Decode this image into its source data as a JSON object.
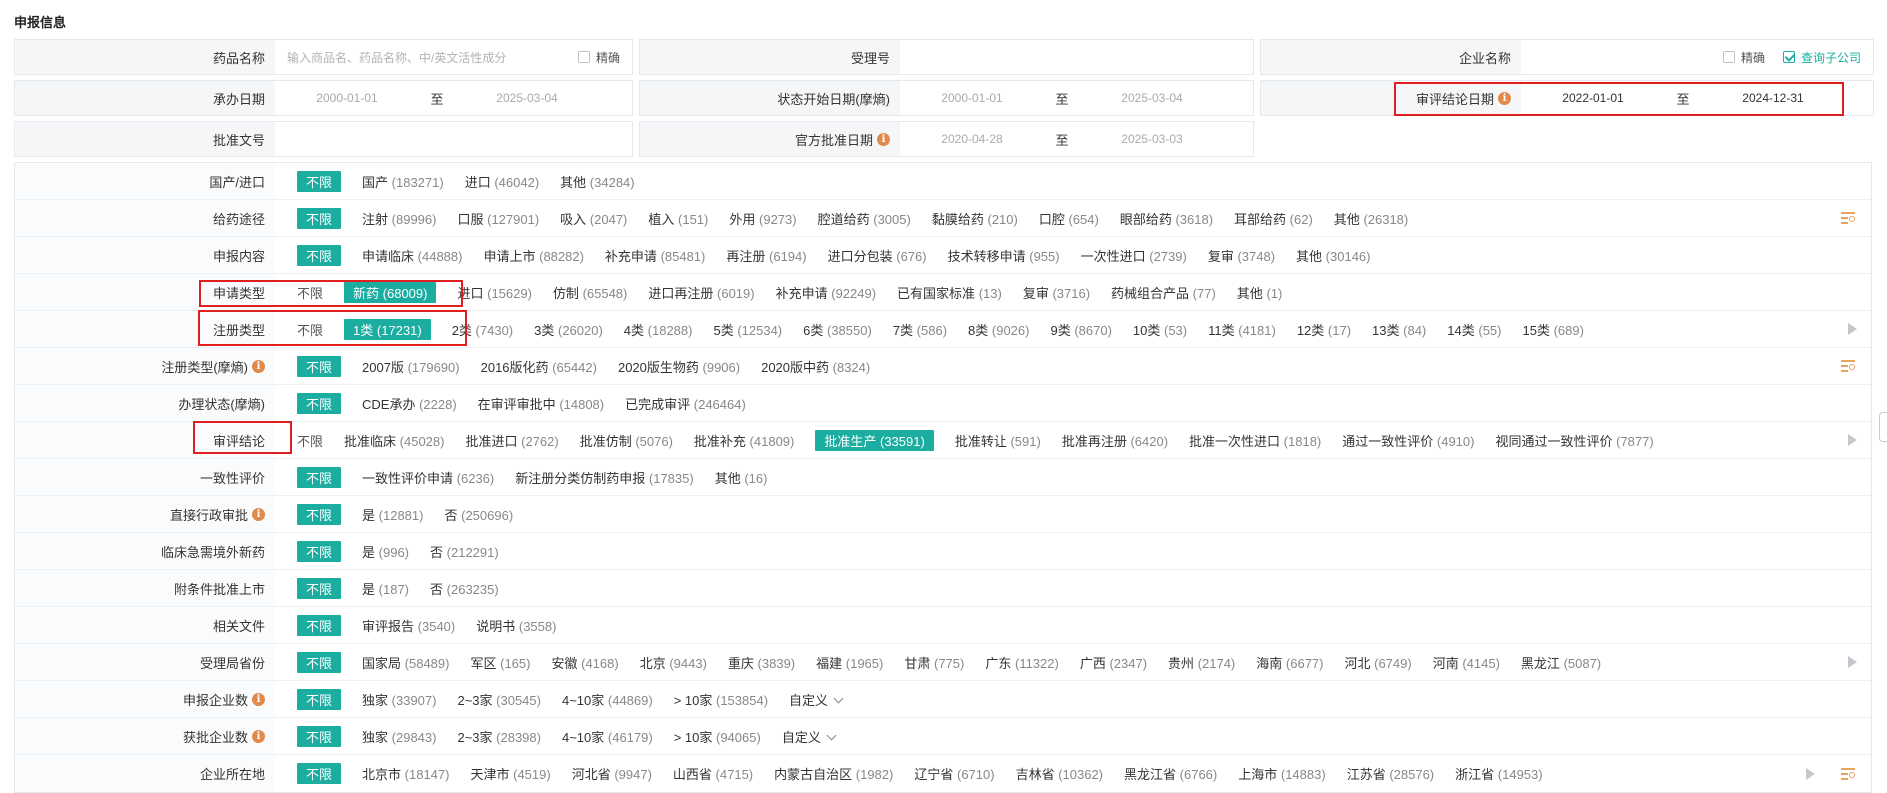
{
  "section_title": "申报信息",
  "form": {
    "row1": {
      "drug_name_label": "药品名称",
      "drug_name_placeholder": "输入商品名、药品名称、中/英文活性成分",
      "exact_label": "精确",
      "accept_no_label": "受理号",
      "company_label": "企业名称",
      "company_exact_label": "精确",
      "subsidiary_label": "查询子公司"
    },
    "row2": {
      "undertake_label": "承办日期",
      "undertake_from": "2000-01-01",
      "undertake_to": "2025-03-04",
      "status_start_label": "状态开始日期(摩熵)",
      "status_from": "2000-01-01",
      "status_to": "2025-03-04",
      "review_date_label": "审评结论日期",
      "review_from": "2022-01-01",
      "review_to": "2024-12-31",
      "to_text": "至"
    },
    "row3": {
      "approval_no_label": "批准文号",
      "official_date_label": "官方批准日期",
      "official_from": "2020-04-28",
      "official_to": "2025-03-03",
      "to_text": "至"
    }
  },
  "filters": [
    {
      "label": "国产/进口",
      "options": [
        {
          "t": "不限",
          "sel": true
        },
        {
          "t": "国产",
          "c": "(183271)"
        },
        {
          "t": "进口",
          "c": "(46042)"
        },
        {
          "t": "其他",
          "c": "(34284)"
        }
      ]
    },
    {
      "label": "给药途径",
      "tools": [
        "list-search"
      ],
      "options": [
        {
          "t": "不限",
          "sel": true
        },
        {
          "t": "注射",
          "c": "(89996)"
        },
        {
          "t": "口服",
          "c": "(127901)"
        },
        {
          "t": "吸入",
          "c": "(2047)"
        },
        {
          "t": "植入",
          "c": "(151)"
        },
        {
          "t": "外用",
          "c": "(9273)"
        },
        {
          "t": "腔道给药",
          "c": "(3005)"
        },
        {
          "t": "黏膜给药",
          "c": "(210)"
        },
        {
          "t": "口腔",
          "c": "(654)"
        },
        {
          "t": "眼部给药",
          "c": "(3618)"
        },
        {
          "t": "耳部给药",
          "c": "(62)"
        },
        {
          "t": "其他",
          "c": "(26318)"
        }
      ]
    },
    {
      "label": "申报内容",
      "options": [
        {
          "t": "不限",
          "sel": true
        },
        {
          "t": "申请临床",
          "c": "(44888)"
        },
        {
          "t": "申请上市",
          "c": "(88282)"
        },
        {
          "t": "补充申请",
          "c": "(85481)"
        },
        {
          "t": "再注册",
          "c": "(6194)"
        },
        {
          "t": "进口分包装",
          "c": "(676)"
        },
        {
          "t": "技术转移申请",
          "c": "(955)"
        },
        {
          "t": "一次性进口",
          "c": "(2739)"
        },
        {
          "t": "复审",
          "c": "(3748)"
        },
        {
          "t": "其他",
          "c": "(30146)"
        }
      ]
    },
    {
      "label": "申请类型",
      "options": [
        {
          "t": "不限",
          "plain": true
        },
        {
          "t": "新药",
          "c": "(68009)",
          "sel": true
        },
        {
          "t": "进口",
          "c": "(15629)"
        },
        {
          "t": "仿制",
          "c": "(65548)"
        },
        {
          "t": "进口再注册",
          "c": "(6019)"
        },
        {
          "t": "补充申请",
          "c": "(92249)"
        },
        {
          "t": "已有国家标准",
          "c": "(13)"
        },
        {
          "t": "复审",
          "c": "(3716)"
        },
        {
          "t": "药械组合产品",
          "c": "(77)"
        },
        {
          "t": "其他",
          "c": "(1)"
        }
      ]
    },
    {
      "label": "注册类型",
      "tools": [
        "play"
      ],
      "options": [
        {
          "t": "不限",
          "plain": true
        },
        {
          "t": "1类",
          "c": "(17231)",
          "sel": true
        },
        {
          "t": "2类",
          "c": "(7430)"
        },
        {
          "t": "3类",
          "c": "(26020)"
        },
        {
          "t": "4类",
          "c": "(18288)"
        },
        {
          "t": "5类",
          "c": "(12534)"
        },
        {
          "t": "6类",
          "c": "(38550)"
        },
        {
          "t": "7类",
          "c": "(586)"
        },
        {
          "t": "8类",
          "c": "(9026)"
        },
        {
          "t": "9类",
          "c": "(8670)"
        },
        {
          "t": "10类",
          "c": "(53)"
        },
        {
          "t": "11类",
          "c": "(4181)"
        },
        {
          "t": "12类",
          "c": "(17)"
        },
        {
          "t": "13类",
          "c": "(84)"
        },
        {
          "t": "14类",
          "c": "(55)"
        },
        {
          "t": "15类",
          "c": "(689)"
        }
      ]
    },
    {
      "label": "注册类型(摩熵)",
      "info": true,
      "tools": [
        "list-search"
      ],
      "options": [
        {
          "t": "不限",
          "sel": true
        },
        {
          "t": "2007版",
          "c": "(179690)"
        },
        {
          "t": "2016版化药",
          "c": "(65442)"
        },
        {
          "t": "2020版生物药",
          "c": "(9906)"
        },
        {
          "t": "2020版中药",
          "c": "(8324)"
        }
      ]
    },
    {
      "label": "办理状态(摩熵)",
      "options": [
        {
          "t": "不限",
          "sel": true
        },
        {
          "t": "CDE承办",
          "c": "(2228)"
        },
        {
          "t": "在审评审批中",
          "c": "(14808)"
        },
        {
          "t": "已完成审评",
          "c": "(246464)"
        }
      ]
    },
    {
      "label": "审评结论",
      "tools": [
        "play"
      ],
      "options": [
        {
          "t": "不限",
          "plain": true
        },
        {
          "t": "批准临床",
          "c": "(45028)"
        },
        {
          "t": "批准进口",
          "c": "(2762)"
        },
        {
          "t": "批准仿制",
          "c": "(5076)"
        },
        {
          "t": "批准补充",
          "c": "(41809)"
        },
        {
          "t": "批准生产",
          "c": "(33591)",
          "sel": true
        },
        {
          "t": "批准转让",
          "c": "(591)"
        },
        {
          "t": "批准再注册",
          "c": "(6420)"
        },
        {
          "t": "批准一次性进口",
          "c": "(1818)"
        },
        {
          "t": "通过一致性评价",
          "c": "(4910)"
        },
        {
          "t": "视同通过一致性评价",
          "c": "(7877)"
        }
      ]
    },
    {
      "label": "一致性评价",
      "options": [
        {
          "t": "不限",
          "sel": true
        },
        {
          "t": "一致性评价申请",
          "c": "(6236)"
        },
        {
          "t": "新注册分类仿制药申报",
          "c": "(17835)"
        },
        {
          "t": "其他",
          "c": "(16)"
        }
      ]
    },
    {
      "label": "直接行政审批",
      "info": true,
      "options": [
        {
          "t": "不限",
          "sel": true
        },
        {
          "t": "是",
          "c": "(12881)"
        },
        {
          "t": "否",
          "c": "(250696)"
        }
      ]
    },
    {
      "label": "临床急需境外新药",
      "options": [
        {
          "t": "不限",
          "sel": true
        },
        {
          "t": "是",
          "c": "(996)"
        },
        {
          "t": "否",
          "c": "(212291)"
        }
      ]
    },
    {
      "label": "附条件批准上市",
      "options": [
        {
          "t": "不限",
          "sel": true
        },
        {
          "t": "是",
          "c": "(187)"
        },
        {
          "t": "否",
          "c": "(263235)"
        }
      ]
    },
    {
      "label": "相关文件",
      "options": [
        {
          "t": "不限",
          "sel": true
        },
        {
          "t": "审评报告",
          "c": "(3540)"
        },
        {
          "t": "说明书",
          "c": "(3558)"
        }
      ]
    },
    {
      "label": "受理局省份",
      "tools": [
        "play"
      ],
      "options": [
        {
          "t": "不限",
          "sel": true
        },
        {
          "t": "国家局",
          "c": "(58489)"
        },
        {
          "t": "军区",
          "c": "(165)"
        },
        {
          "t": "安徽",
          "c": "(4168)"
        },
        {
          "t": "北京",
          "c": "(9443)"
        },
        {
          "t": "重庆",
          "c": "(3839)"
        },
        {
          "t": "福建",
          "c": "(1965)"
        },
        {
          "t": "甘肃",
          "c": "(775)"
        },
        {
          "t": "广东",
          "c": "(11322)"
        },
        {
          "t": "广西",
          "c": "(2347)"
        },
        {
          "t": "贵州",
          "c": "(2174)"
        },
        {
          "t": "海南",
          "c": "(6677)"
        },
        {
          "t": "河北",
          "c": "(6749)"
        },
        {
          "t": "河南",
          "c": "(4145)"
        },
        {
          "t": "黑龙江",
          "c": "(5087)"
        }
      ]
    },
    {
      "label": "申报企业数",
      "info": true,
      "options": [
        {
          "t": "不限",
          "sel": true
        },
        {
          "t": "独家",
          "c": "(33907)"
        },
        {
          "t": "2~3家",
          "c": "(30545)"
        },
        {
          "t": "4~10家",
          "c": "(44869)"
        },
        {
          "t": "> 10家",
          "c": "(153854)"
        },
        {
          "t": "自定义",
          "custom": true
        }
      ]
    },
    {
      "label": "获批企业数",
      "info": true,
      "options": [
        {
          "t": "不限",
          "sel": true
        },
        {
          "t": "独家",
          "c": "(29843)"
        },
        {
          "t": "2~3家",
          "c": "(28398)"
        },
        {
          "t": "4~10家",
          "c": "(46179)"
        },
        {
          "t": "> 10家",
          "c": "(94065)"
        },
        {
          "t": "自定义",
          "custom": true
        }
      ]
    },
    {
      "label": "企业所在地",
      "tools": [
        "play",
        "list-search"
      ],
      "options": [
        {
          "t": "不限",
          "sel": true
        },
        {
          "t": "北京市",
          "c": "(18147)"
        },
        {
          "t": "天津市",
          "c": "(4519)"
        },
        {
          "t": "河北省",
          "c": "(9947)"
        },
        {
          "t": "山西省",
          "c": "(4715)"
        },
        {
          "t": "内蒙古自治区",
          "c": "(1982)"
        },
        {
          "t": "辽宁省",
          "c": "(6710)"
        },
        {
          "t": "吉林省",
          "c": "(10362)"
        },
        {
          "t": "黑龙江省",
          "c": "(6766)"
        },
        {
          "t": "上海市",
          "c": "(14883)"
        },
        {
          "t": "江苏省",
          "c": "(28576)"
        },
        {
          "t": "浙江省",
          "c": "(14953)"
        }
      ]
    }
  ],
  "colors": {
    "accent": "#1aada0",
    "highlight_box": "#e02020",
    "info": "#e08a4b"
  }
}
